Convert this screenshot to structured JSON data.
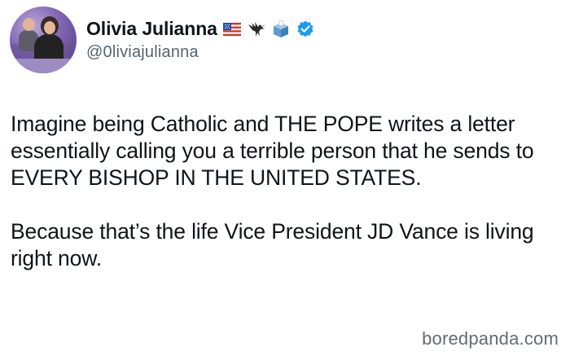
{
  "user": {
    "display_name": "Olivia Julianna",
    "handle": "@0liviajulianna",
    "badges": [
      "us-flag-icon",
      "eagle-icon",
      "ballot-box-icon",
      "verified-badge-icon"
    ]
  },
  "tweet": {
    "paragraphs": [
      "Imagine being Catholic and THE POPE writes a letter essentially calling you a terrible person that he sends to EVERY BISHOP IN THE UNITED STATES.",
      "Because that’s the life Vice President JD Vance is living right now."
    ]
  },
  "watermark": "boredpanda.com",
  "colors": {
    "text": "#0f1419",
    "secondary": "#536471",
    "verified": "#1d9bf0",
    "background": "#ffffff"
  }
}
